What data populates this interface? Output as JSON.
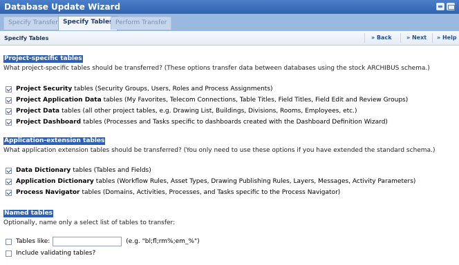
{
  "window": {
    "title": "Database Update Wizard",
    "icons": [
      "print-icon",
      "mail-icon"
    ]
  },
  "tabs": [
    {
      "label": "Specify Transfer",
      "active": false
    },
    {
      "label": "Specify Tables",
      "active": true
    },
    {
      "label": "Perform Transfer",
      "active": false
    }
  ],
  "subheader": {
    "title": "Specify Tables",
    "back": "» Back",
    "next": "» Next",
    "help": "» Help"
  },
  "project": {
    "title": "Project-specific tables",
    "description": "What project-specific tables should be transferred? (These options transfer data between databases using the stock ARCHIBUS schema.)",
    "items": [
      {
        "name": "Project Security",
        "desc": "tables (Security Groups, Users, Roles and Process Assignments)",
        "checked": true
      },
      {
        "name": "Project Application Data",
        "desc": "tables (My Favorites, Telecom Connections, Table Titles, Field Titles, Field Edit and Review Groups)",
        "checked": true
      },
      {
        "name": "Project Data",
        "desc": "tables (all other project tables, e.g. Drawing List, Buildings, Divisions, Rooms, Employees, etc.)",
        "checked": true
      },
      {
        "name": "Project Dashboard",
        "desc": "tables (Processes and Tasks specific to dashboards created with the Dashboard Definition Wizard)",
        "checked": true
      }
    ]
  },
  "extension": {
    "title": "Application-extension tables",
    "description": "What application extension tables should be transferred? (You only need to use these options if you have extended the standard schema.)",
    "items": [
      {
        "name": "Data Dictionary",
        "desc": "tables (Tables and Fields)",
        "checked": true
      },
      {
        "name": "Application Dictionary",
        "desc": "tables (Workflow Rules, Asset Types, Drawing Publishing Rules, Layers, Messages, Activity Parameters)",
        "checked": true
      },
      {
        "name": "Process Navigator",
        "desc": "tables (Domains, Activities, Processes, and Tasks specific to the Process Navigator)",
        "checked": true
      }
    ]
  },
  "named": {
    "title": "Named tables",
    "description": "Optionally, name only a select list of tables to transfer:",
    "tables_like_label": "Tables like:",
    "tables_like_value": "",
    "tables_like_hint": "(e.g. \"bl;fl;rm%;em_%\")",
    "tables_like_checked": false,
    "include_validating_label": "Include validating tables?",
    "include_validating_checked": false
  }
}
